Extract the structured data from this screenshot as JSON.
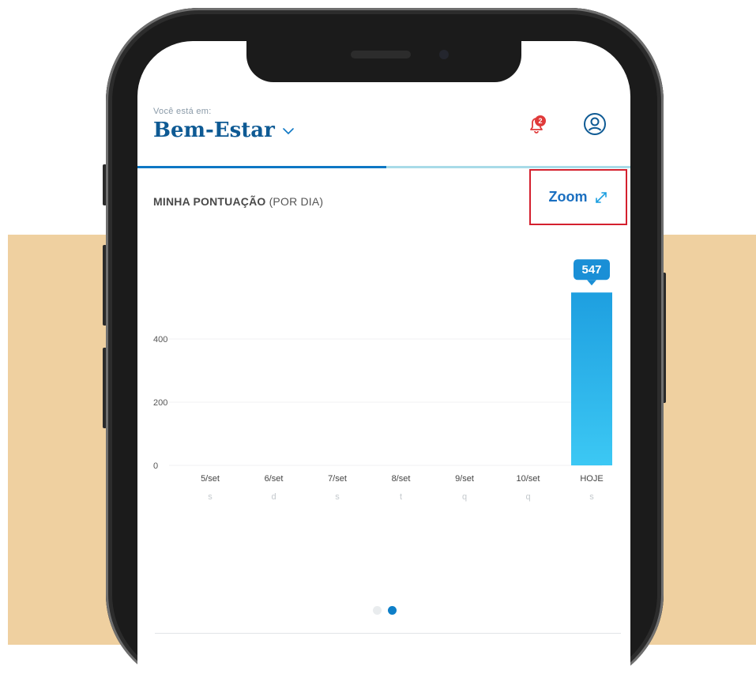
{
  "header": {
    "subtitle": "Você está em:",
    "section": "Bem-Estar",
    "notification_count": "2"
  },
  "chart_header": {
    "title_bold": "MINHA PONTUAÇÃO",
    "title_rest": " (POR DIA)",
    "zoom_label": "Zoom"
  },
  "chart_data": {
    "type": "bar",
    "categories": [
      "5/set",
      "6/set",
      "7/set",
      "8/set",
      "9/set",
      "10/set",
      "HOJE"
    ],
    "weekdays": [
      "s",
      "d",
      "s",
      "t",
      "q",
      "q",
      "s"
    ],
    "values": [
      0,
      0,
      0,
      0,
      0,
      0,
      547
    ],
    "value_label": "547",
    "yticks": [
      0,
      200,
      400
    ],
    "ylim": [
      0,
      600
    ],
    "grid": true,
    "bar_color_top": "#1e9fe0",
    "bar_color_bottom": "#3cc8f4"
  },
  "pagination": {
    "pages": 2,
    "active": 1
  },
  "colors": {
    "brand": "#0e5a94",
    "accent": "#0e77c4",
    "badge": "#e03a3a",
    "highlight": "#d4202e",
    "backdrop": "#efd0a0"
  }
}
